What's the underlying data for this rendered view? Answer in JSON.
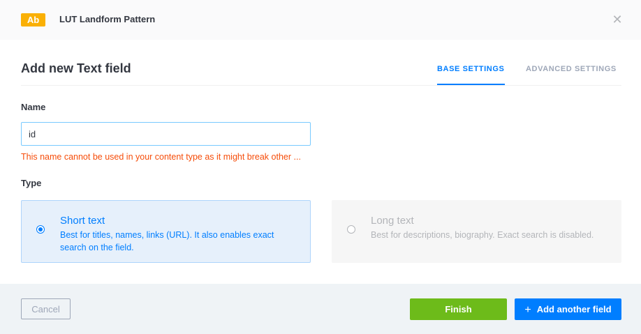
{
  "header": {
    "badge": "Ab",
    "title": "LUT Landform Pattern",
    "close_icon": "close-icon"
  },
  "modal": {
    "title": "Add new Text field",
    "tabs": [
      {
        "label": "BASE SETTINGS",
        "active": true
      },
      {
        "label": "ADVANCED SETTINGS",
        "active": false
      }
    ]
  },
  "form": {
    "name_label": "Name",
    "name_value": "id",
    "name_error": "This name cannot be used in your content type as it might break other ...",
    "type_label": "Type",
    "types": [
      {
        "title": "Short text",
        "description": "Best for titles, names, links (URL). It also enables exact search on the field.",
        "selected": true
      },
      {
        "title": "Long text",
        "description": "Best for descriptions, biography. Exact search is disabled.",
        "selected": false
      }
    ]
  },
  "footer": {
    "cancel_label": "Cancel",
    "finish_label": "Finish",
    "add_another_label": "Add another field",
    "add_icon": "plus-icon"
  },
  "colors": {
    "accent": "#007eff",
    "success": "#6dbb1a",
    "error": "#f64d0a",
    "badge": "#fab005"
  }
}
